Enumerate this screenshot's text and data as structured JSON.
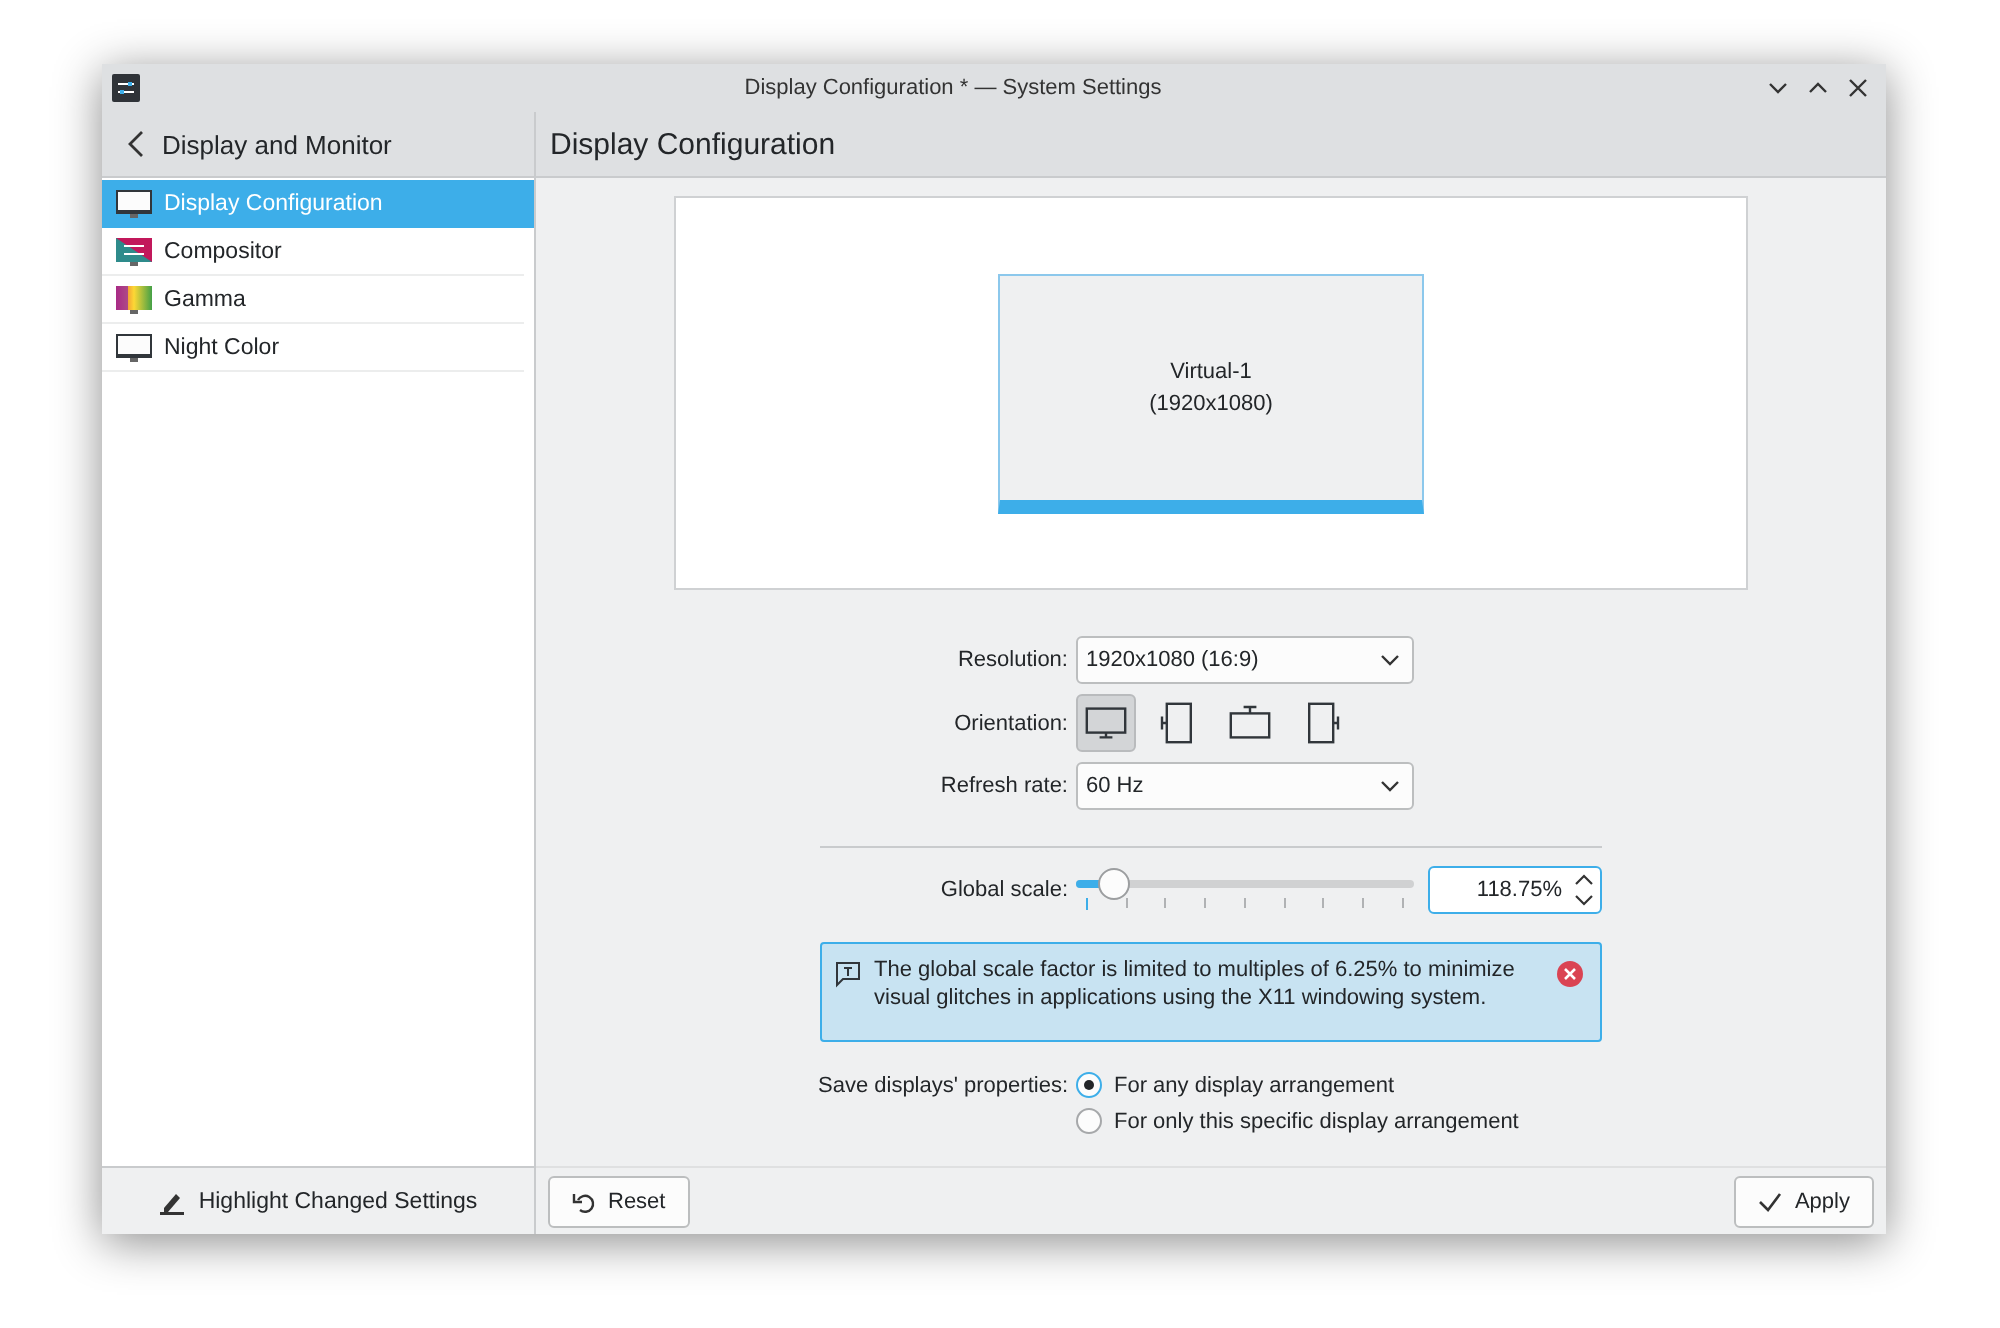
{
  "window": {
    "title": "Display Configuration * — System Settings"
  },
  "sidebar": {
    "back_title": "Display and Monitor",
    "items": [
      {
        "label": "Display Configuration",
        "selected": true,
        "kind": "monitor"
      },
      {
        "label": "Compositor",
        "selected": false,
        "kind": "compositor"
      },
      {
        "label": "Gamma",
        "selected": false,
        "kind": "gamma"
      },
      {
        "label": "Night Color",
        "selected": false,
        "kind": "monitor"
      }
    ],
    "footer_button": "Highlight Changed Settings"
  },
  "page": {
    "title": "Display Configuration",
    "preview": {
      "output_name": "Virtual-1",
      "output_mode": "(1920x1080)",
      "selected": true
    },
    "resolution": {
      "label": "Resolution:",
      "value": "1920x1080 (16:9)"
    },
    "orientation": {
      "label": "Orientation:",
      "options": [
        {
          "kind": "landscape",
          "selected": true
        },
        {
          "kind": "left",
          "selected": false
        },
        {
          "kind": "flipped",
          "selected": false
        },
        {
          "kind": "right",
          "selected": false
        }
      ]
    },
    "refresh_rate": {
      "label": "Refresh rate:",
      "value": "60 Hz"
    },
    "global_scale": {
      "label": "Global scale:",
      "level": 0.11,
      "value": "118.75%"
    },
    "message": "The global scale factor is limited to multiples of 6.25% to minimize visual glitches in applications using the X11 windowing system.",
    "save_properties": {
      "label": "Save displays' properties:",
      "options": [
        {
          "label": "For any display arrangement",
          "selected": true
        },
        {
          "label": "For only this specific display arrangement",
          "selected": false
        }
      ]
    },
    "buttons": {
      "reset": "Reset",
      "apply": "Apply"
    }
  }
}
